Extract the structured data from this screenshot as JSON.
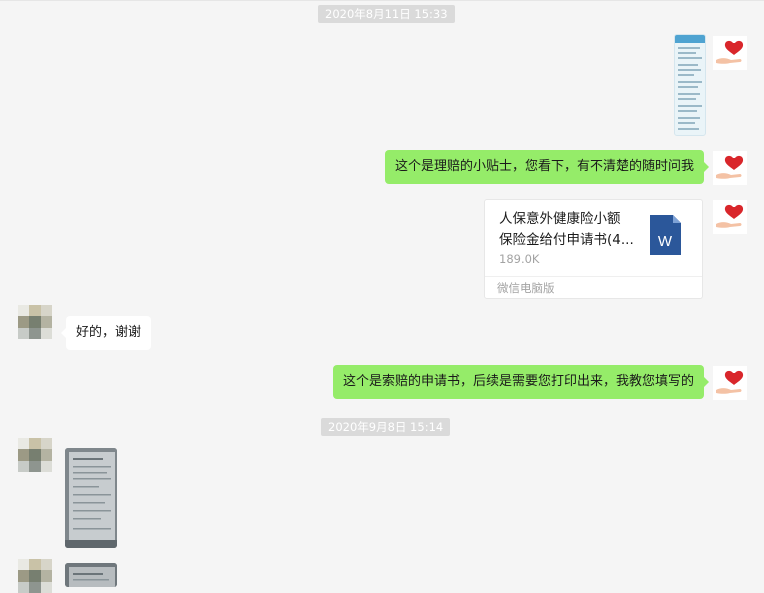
{
  "chat": {
    "timestamps": [
      "2020年8月11日 15:33",
      "2020年9月8日 15:14"
    ],
    "messages": {
      "tips": "这个是理赔的小贴士，您看下，有不清楚的随时问我",
      "thanks": "好的，谢谢",
      "form": "这个是索赔的申请书，后续是需要您打印出来，我教您填写的"
    },
    "file": {
      "name_line1": "人保意外健康险小额",
      "name_line2": "保险金给付申请书(4...",
      "size": "189.0K",
      "source": "微信电脑版",
      "icon": "word-file-icon",
      "icon_letter": "W"
    },
    "colors": {
      "bubble_sent": "#95ec69",
      "bubble_received": "#ffffff",
      "background": "#f5f5f5",
      "word_blue": "#2b579a"
    }
  }
}
